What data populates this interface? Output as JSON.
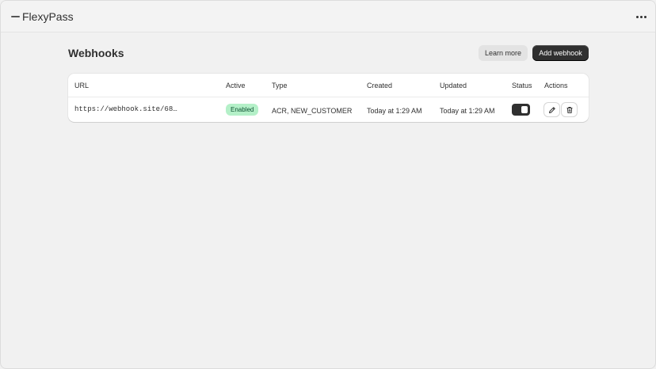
{
  "app": {
    "title": "FlexyPass",
    "logo_icon": "app-logo-icon",
    "more_icon": "more-horizontal-icon"
  },
  "page": {
    "title": "Webhooks",
    "learn_more_label": "Learn more",
    "add_webhook_label": "Add webhook"
  },
  "table": {
    "columns": [
      "URL",
      "Active",
      "Type",
      "Created",
      "Updated",
      "Status",
      "Actions"
    ],
    "rows": [
      {
        "url": "https://webhook.site/68…",
        "active": "Enabled",
        "type": "ACR, NEW_CUSTOMER",
        "created": "Today at 1:29 AM",
        "updated": "Today at 1:29 AM",
        "status_on": true,
        "actions": [
          "edit-icon",
          "trash-icon"
        ]
      }
    ]
  },
  "colors": {
    "primary": "#303030",
    "badge_bg": "#b4f0c8",
    "background": "#f1f1f1"
  }
}
